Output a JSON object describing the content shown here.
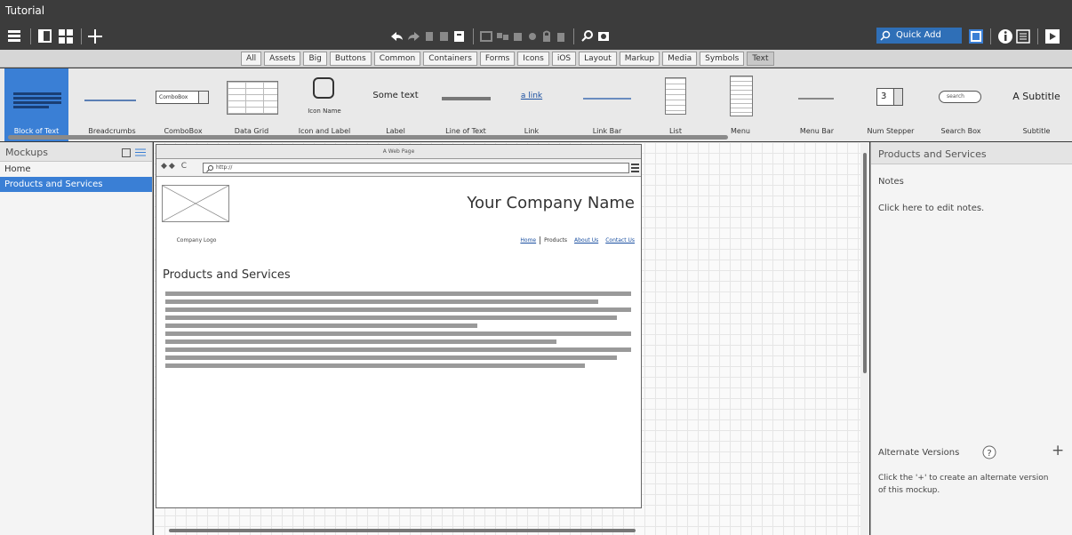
{
  "app": {
    "title": "Tutorial"
  },
  "toolbar": {
    "quick_add": "Quick Add"
  },
  "library": {
    "tabs": [
      {
        "label": "All"
      },
      {
        "label": "Assets"
      },
      {
        "label": "Big"
      },
      {
        "label": "Buttons"
      },
      {
        "label": "Common"
      },
      {
        "label": "Containers"
      },
      {
        "label": "Forms"
      },
      {
        "label": "Icons"
      },
      {
        "label": "iOS"
      },
      {
        "label": "Layout"
      },
      {
        "label": "Markup"
      },
      {
        "label": "Media"
      },
      {
        "label": "Symbols"
      },
      {
        "label": "Text"
      }
    ],
    "active_tab": "Text",
    "components": {
      "block_of_text": "Block of Text",
      "breadcrumbs": "Breadcrumbs",
      "combobox": "ComboBox",
      "combobox_preview": "ComboBox",
      "data_grid": "Data Grid",
      "icon_and_label": "Icon and Label",
      "icon_name": "Icon Name",
      "label": "Label",
      "label_preview": "Some text",
      "line_of_text": "Line of Text",
      "link": "Link",
      "link_preview": "a link",
      "link_bar": "Link Bar",
      "list": "List",
      "menu": "Menu",
      "menu_bar": "Menu Bar",
      "num_stepper": "Num Stepper",
      "num_stepper_value": "3",
      "search_box": "Search Box",
      "search_preview": "search",
      "subtitle": "Subtitle",
      "subtitle_preview": "A Subtitle"
    }
  },
  "mockups": {
    "header": "Mockups",
    "items": [
      {
        "label": "Home"
      },
      {
        "label": "Products and Services"
      }
    ],
    "selected": "Products and Services"
  },
  "mockup_page": {
    "window_title": "A Web Page",
    "url": "http://",
    "logo_caption": "Company Logo",
    "company_name": "Your Company Name",
    "nav": {
      "home": "Home",
      "products": "Products",
      "about": "About Us",
      "contact": "Contact Us"
    },
    "heading": "Products and Services"
  },
  "inspector": {
    "header": "Products and Services",
    "notes_label": "Notes",
    "notes_hint": "Click here to edit notes.",
    "alt_label": "Alternate Versions",
    "alt_hint": "Click the '+' to create an alternate version of this mockup."
  },
  "colors": {
    "selection": "#3a7fd5",
    "toolbar_bg": "#3c3c3c",
    "link": "#1a4fa0"
  }
}
